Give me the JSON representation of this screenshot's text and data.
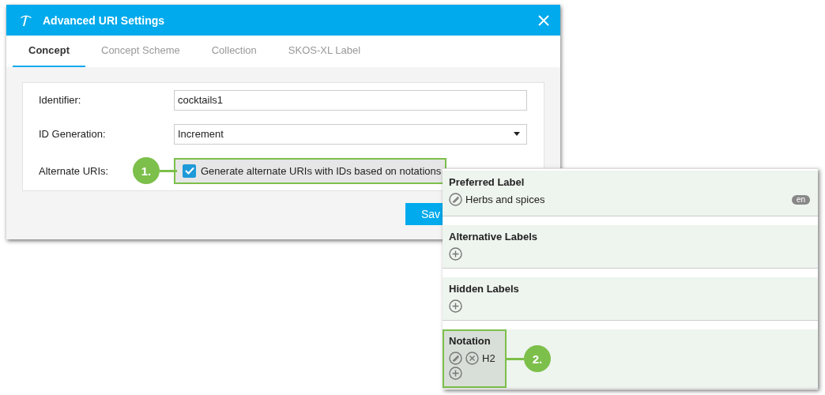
{
  "window": {
    "title": "Advanced URI Settings"
  },
  "tabs": [
    {
      "label": "Concept",
      "selected": true
    },
    {
      "label": "Concept Scheme",
      "selected": false
    },
    {
      "label": "Collection",
      "selected": false
    },
    {
      "label": "SKOS-XL Label",
      "selected": false
    }
  ],
  "form": {
    "identifier": {
      "label": "Identifier:",
      "value": "cocktails1"
    },
    "id_generation": {
      "label": "ID Generation:",
      "value": "Increment"
    },
    "alternate_uris": {
      "label": "Alternate URIs:",
      "checkbox_label": "Generate alternate URIs with IDs based on notations",
      "checked": true,
      "highlighted": true,
      "callout": "1."
    }
  },
  "save_button": "Sav",
  "label_panel": {
    "sections": [
      {
        "title": "Preferred Label",
        "highlighted": false,
        "add": false,
        "items": [
          {
            "text": "Herbs and spices",
            "lang": "en",
            "removable": false
          }
        ]
      },
      {
        "title": "Alternative Labels",
        "highlighted": false,
        "add": true
      },
      {
        "title": "Hidden Labels",
        "highlighted": false,
        "add": true
      },
      {
        "title": "Notation",
        "highlighted": true,
        "callout": "2.",
        "add": true,
        "items": [
          {
            "text": "H2",
            "removable": true
          }
        ]
      }
    ]
  }
}
